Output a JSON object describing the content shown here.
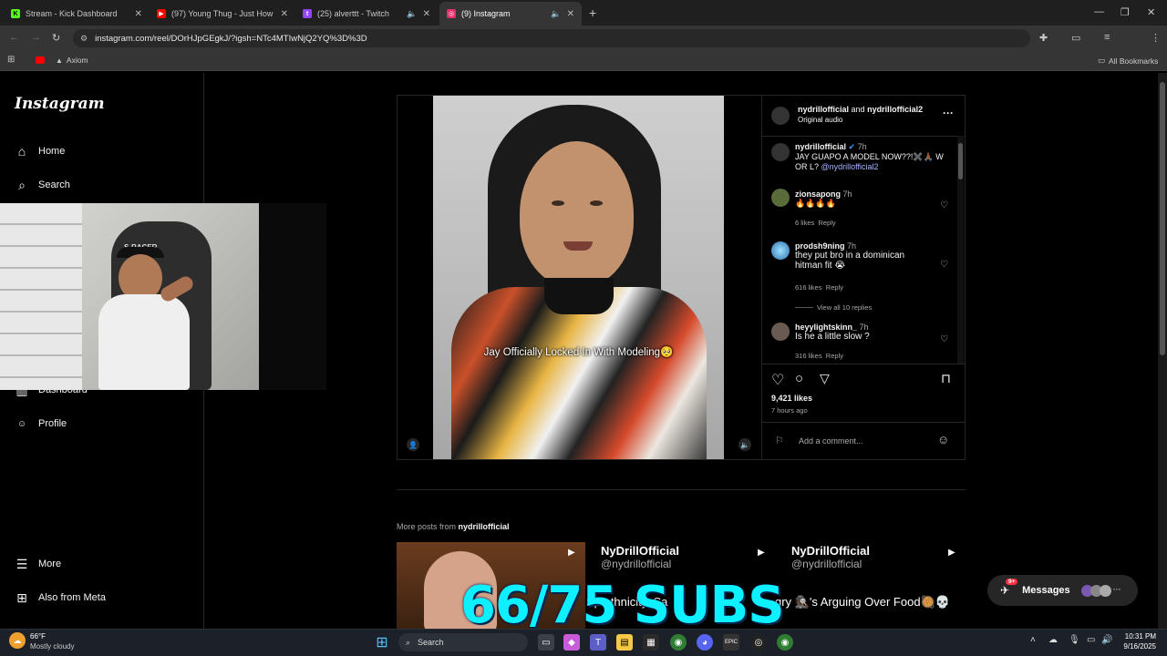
{
  "browser": {
    "tabs": [
      {
        "title": "Stream - Kick Dashboard",
        "favicon": "K",
        "color": "#53fc18"
      },
      {
        "title": "(97) Young Thug - Just How It Is",
        "favicon": "▶",
        "color": "#ff0000"
      },
      {
        "title": "(25) alverttt - Twitch",
        "favicon": "t",
        "color": "#9146ff"
      },
      {
        "title": "(9) Instagram",
        "favicon": "◎",
        "color": "#e1306c"
      }
    ],
    "url": "instagram.com/reel/DOrHJpGEgkJ/?igsh=NTc4MTIwNjQ2YQ%3D%3D",
    "bookmark_label": "Axiom",
    "all_bookmarks": "All Bookmarks",
    "profile_initial": "M"
  },
  "instagram": {
    "logo": "Instagram",
    "nav": {
      "home": "Home",
      "search": "Search",
      "dashboard": "Dashboard",
      "profile": "Profile",
      "more": "More",
      "also_from_meta": "Also from Meta"
    },
    "post": {
      "header_user1": "nydrillofficial",
      "header_and": "and",
      "header_user2": "nydrillofficial2",
      "audio": "Original audio",
      "video_caption": "Jay Officially Locked In With Modeling🥺",
      "caption_user": "nydrillofficial",
      "caption_time": "7h",
      "caption_text": "JAY GUAPO A MODEL NOW??!✖️🙏🏾 W OR L?",
      "caption_mention": "@nydrillofficial2",
      "comments": [
        {
          "user": "zionsapong",
          "time": "7h",
          "text": "🔥🔥🔥🔥",
          "likes": "6 likes",
          "reply": "Reply"
        },
        {
          "user": "prodsh9ning",
          "time": "7h",
          "text": "they put bro in a dominican hitman fit 😭",
          "likes": "616 likes",
          "reply": "Reply"
        },
        {
          "user": "heyylightskinn_",
          "time": "7h",
          "text": "Is he a little slow ?",
          "likes": "316 likes",
          "reply": "Reply"
        }
      ],
      "view_replies": "View all 10 replies",
      "likes": "9,421 likes",
      "posted": "7 hours ago",
      "add_comment": "Add a comment..."
    },
    "more_posts_label": "More posts from",
    "more_posts_user": "nydrillofficial",
    "thumbs": [
      {
        "name": "NyDrillOfficial",
        "handle": "@nydrillofficial",
        "text": "Sp  ethnicity, Sa"
      },
      {
        "name": "NyDrillOfficial",
        "handle": "@nydrillofficial",
        "text": "gry 🕵🏿's Arguing Over Food🥘💀"
      }
    ],
    "messages_label": "Messages",
    "messages_badge": "9+"
  },
  "overlay": {
    "subs": "66/75 SUBS",
    "webcam_chair_text": "S-RACER"
  },
  "taskbar": {
    "weather_temp": "66°F",
    "weather_desc": "Mostly cloudy",
    "search_label": "Search",
    "time": "10:31 PM",
    "date": "9/16/2025"
  }
}
